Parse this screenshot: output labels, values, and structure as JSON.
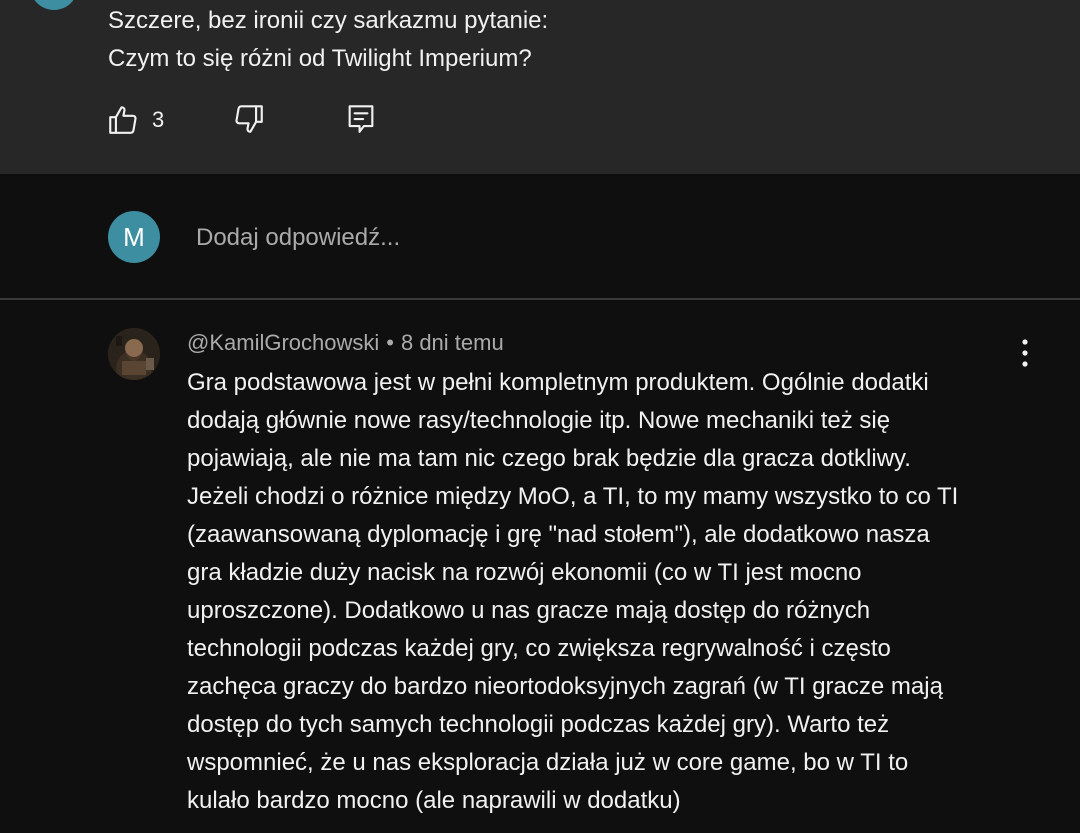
{
  "parent_comment": {
    "lines": [
      "Szczere, bez ironii czy sarkazmu pytanie:",
      "Czym to się różni od Twilight Imperium?"
    ],
    "like_count": "3",
    "icons": [
      "thumbs-up-icon",
      "thumbs-down-icon",
      "reply-icon"
    ]
  },
  "reply_box": {
    "avatar_letter": "M",
    "avatar_color": "#3d8ea0",
    "placeholder": "Dodaj odpowiedź..."
  },
  "comment": {
    "author": "@KamilGrochowski",
    "separator": "•",
    "time": "8 dni temu",
    "lines": [
      "Gra podstawowa jest w pełni kompletnym produktem. Ogólnie dodatki",
      "dodają głównie nowe rasy/technologie itp. Nowe mechaniki też się",
      "pojawiają, ale nie ma tam nic czego brak będzie dla gracza dotkliwy.",
      "Jeżeli chodzi o różnice między MoO, a TI, to my mamy wszystko to co TI",
      "(zaawansowaną dyplomację i grę \"nad stołem\"), ale dodatkowo nasza",
      "gra kładzie duży nacisk na rozwój ekonomii (co w TI jest mocno",
      "uproszczone). Dodatkowo u nas gracze mają dostęp do różnych",
      "technologii podczas każdej gry, co zwiększa regrywalność i często",
      "zachęca graczy do bardzo nieortodoksyjnych zagrań (w TI gracze mają",
      "dostęp do tych samych technologii podczas każdej gry). Warto też",
      "wspomnieć, że u nas eksploracja działa już w core game, bo w TI to",
      "kulało bardzo mocno (ale naprawili w dodatku)"
    ],
    "menu_icon": "more-vertical-icon"
  },
  "colors": {
    "background": "#0f0f0f",
    "parent_background": "#272727",
    "text": "#f1f1f1",
    "secondary_text": "#aaaaaa",
    "divider": "#3a3a3a"
  }
}
